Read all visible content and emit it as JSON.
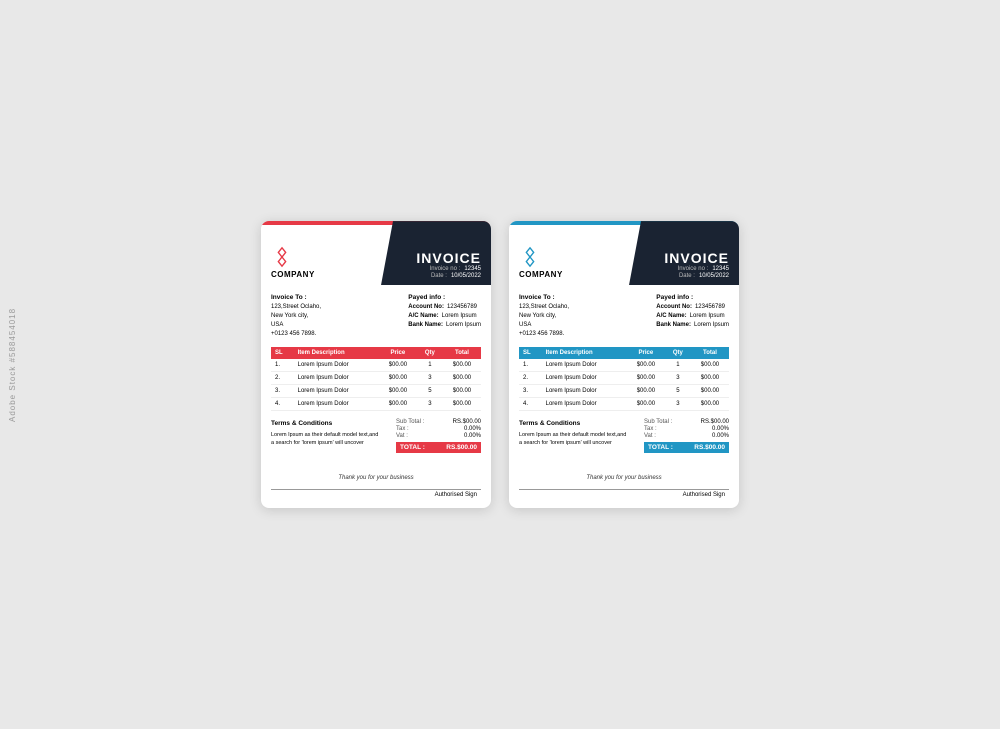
{
  "watermark": "Adobe Stock #588454018",
  "invoice1": {
    "accent_color": "#e63946",
    "accent_color_secondary": "#e63946",
    "header": {
      "company_name": "COMPANY",
      "invoice_title": "INVOICE",
      "invoice_no_label": "Invoice no :",
      "invoice_no": "12345",
      "date_label": "Date :",
      "date": "10/05/2022"
    },
    "bill_to": {
      "label": "Invoice To :",
      "line1": "123,Street Oclaho,",
      "line2": "New York city,",
      "line3": "USA",
      "line4": "+0123 456 7898."
    },
    "payment_info": {
      "label": "Payed info :",
      "account_no_label": "Account No:",
      "account_no": "123456789",
      "ac_name_label": "A/C Name:",
      "ac_name": "Lorem  Ipsum",
      "bank_name_label": "Bank Name:",
      "bank_name": "Lorem  Ipsum"
    },
    "table": {
      "headers": [
        "SL",
        "Item Description",
        "Price",
        "Qty",
        "Total"
      ],
      "rows": [
        {
          "sl": "1.",
          "desc": "Lorem  Ipsum  Dolor",
          "price": "$00.00",
          "qty": "1",
          "total": "$00.00"
        },
        {
          "sl": "2.",
          "desc": "Lorem  Ipsum  Dolor",
          "price": "$00.00",
          "qty": "3",
          "total": "$00.00"
        },
        {
          "sl": "3.",
          "desc": "Lorem  Ipsum  Dolor",
          "price": "$00.00",
          "qty": "5",
          "total": "$00.00"
        },
        {
          "sl": "4.",
          "desc": "Lorem  Ipsum  Dolor",
          "price": "$00.00",
          "qty": "3",
          "total": "$00.00"
        }
      ]
    },
    "terms": {
      "title": "Terms & Conditions",
      "text": "Lorem Ipsum as their default model text,and a search for 'lorem ipsum' will uncover"
    },
    "totals": {
      "sub_total_label": "Sub Total :",
      "sub_total": "RS.$00.00",
      "tax_label": "Tax :",
      "tax": "0.00%",
      "vat_label": "Vat :",
      "vat": "0.00%",
      "total_label": "TOTAL :",
      "total": "RS.$00.00"
    },
    "thank_you": "Thank you for your business",
    "authorised": "Authorised  Sign"
  },
  "invoice2": {
    "accent_color": "#2196c4",
    "header": {
      "company_name": "COMPANY",
      "invoice_title": "INVOICE",
      "invoice_no_label": "Invoice no :",
      "invoice_no": "12345",
      "date_label": "Date :",
      "date": "10/05/2022"
    },
    "bill_to": {
      "label": "Invoice To :",
      "line1": "123,Street Oclaho,",
      "line2": "New York city,",
      "line3": "USA",
      "line4": "+0123 456 7898."
    },
    "payment_info": {
      "label": "Payed info :",
      "account_no_label": "Account No:",
      "account_no": "123456789",
      "ac_name_label": "A/C Name:",
      "ac_name": "Lorem  Ipsum",
      "bank_name_label": "Bank Name:",
      "bank_name": "Lorem  Ipsum"
    },
    "table": {
      "headers": [
        "SL",
        "Item Description",
        "Price",
        "Qty",
        "Total"
      ],
      "rows": [
        {
          "sl": "1.",
          "desc": "Lorem  Ipsum  Dolor",
          "price": "$00.00",
          "qty": "1",
          "total": "$00.00"
        },
        {
          "sl": "2.",
          "desc": "Lorem  Ipsum  Dolor",
          "price": "$00.00",
          "qty": "3",
          "total": "$00.00"
        },
        {
          "sl": "3.",
          "desc": "Lorem  Ipsum  Dolor",
          "price": "$00.00",
          "qty": "5",
          "total": "$00.00"
        },
        {
          "sl": "4.",
          "desc": "Lorem  Ipsum  Dolor",
          "price": "$00.00",
          "qty": "3",
          "total": "$00.00"
        }
      ]
    },
    "terms": {
      "title": "Terms & Conditions",
      "text": "Lorem Ipsum as their default model text,and a search for 'lorem ipsum' will uncover"
    },
    "totals": {
      "sub_total_label": "Sub Total :",
      "sub_total": "RS.$00.00",
      "tax_label": "Tax :",
      "tax": "0.00%",
      "vat_label": "Vat :",
      "vat": "0.00%",
      "total_label": "TOTAL :",
      "total": "RS.$00.00"
    },
    "thank_you": "Thank you for your business",
    "authorised": "Authorised  Sign"
  }
}
